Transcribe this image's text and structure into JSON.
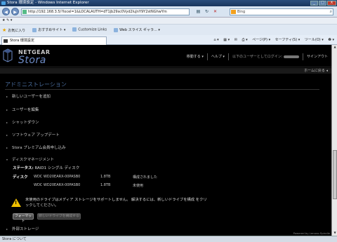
{
  "window": {
    "title": "Stora 環境設定 - Windows Internet Explorer",
    "controls": [
      "_",
      "□",
      "X"
    ]
  },
  "browser": {
    "url": "http://192.168.3.5/?locel=1&LOCALAUTH=dT1jb29sc0Vyd2luJnY9Y2stNGhwYm",
    "search_placeholder": "Bing",
    "menu": "★ ✎ ▾",
    "favorites_label": "お気に入り",
    "suggested_sites": "おすすめサイト ▾",
    "customize_links": "Customize Links",
    "web_slices": "Web スライス ギャラ... ▾",
    "tab_title": "Stora 環境設定",
    "cmd": {
      "page": "ページ(P) ▾",
      "safety": "セーフティ(S) ▾",
      "tools": "ツール(O) ▾",
      "help": "❷ ▾"
    }
  },
  "header": {
    "brand_top": "NETGEAR",
    "brand_name": "Stora",
    "nav": {
      "goto": "移動する ▾",
      "help": "ヘルプ ▾",
      "login_prefix": "以下のユーザーとしてログイン:",
      "signout": "サインアウト"
    }
  },
  "subbar": {
    "home_back": "ホームに戻る ◂"
  },
  "admin": {
    "title": "アドミニストレーション",
    "items": [
      {
        "label": "新しいユーザーを追加",
        "arrow": "▸"
      },
      {
        "label": "ユーザーを編集",
        "arrow": "▸"
      },
      {
        "label": "シャットダウン",
        "arrow": "▸"
      },
      {
        "label": "ソフトウェア アップデート",
        "arrow": "▸"
      },
      {
        "label": "Stora プレミアム会員申し込み",
        "arrow": "▸"
      }
    ],
    "disk_mgmt": {
      "label": "ディスクマネージメント",
      "arrow": "▾",
      "status_label": "ステータス:",
      "status_value": "RAID1 シングル ディスク",
      "disk_label": "ディスク",
      "disks": [
        {
          "model": "WDC WD20EARX-00PASB0",
          "size": "1.8TB",
          "state": "構成されました"
        },
        {
          "model": "WDC WD20EARX-00PASB0",
          "size": "1.8TB",
          "state": "未使用"
        }
      ],
      "warning": "未使用のドライブはメディア ストレージをサポートしません。 解決するには、新しいドライブを構成 をクリックしてください。",
      "warn_glyph": "!",
      "format_btn": "フォーマット",
      "configure_btn": "新しいドライブを構成する"
    },
    "external": {
      "label": "外部ストレージ",
      "arrow": "▸"
    }
  },
  "statusbar": {
    "text": "Stora について"
  },
  "footer": {
    "powered": "Powered by Lenovo-Spindle"
  }
}
